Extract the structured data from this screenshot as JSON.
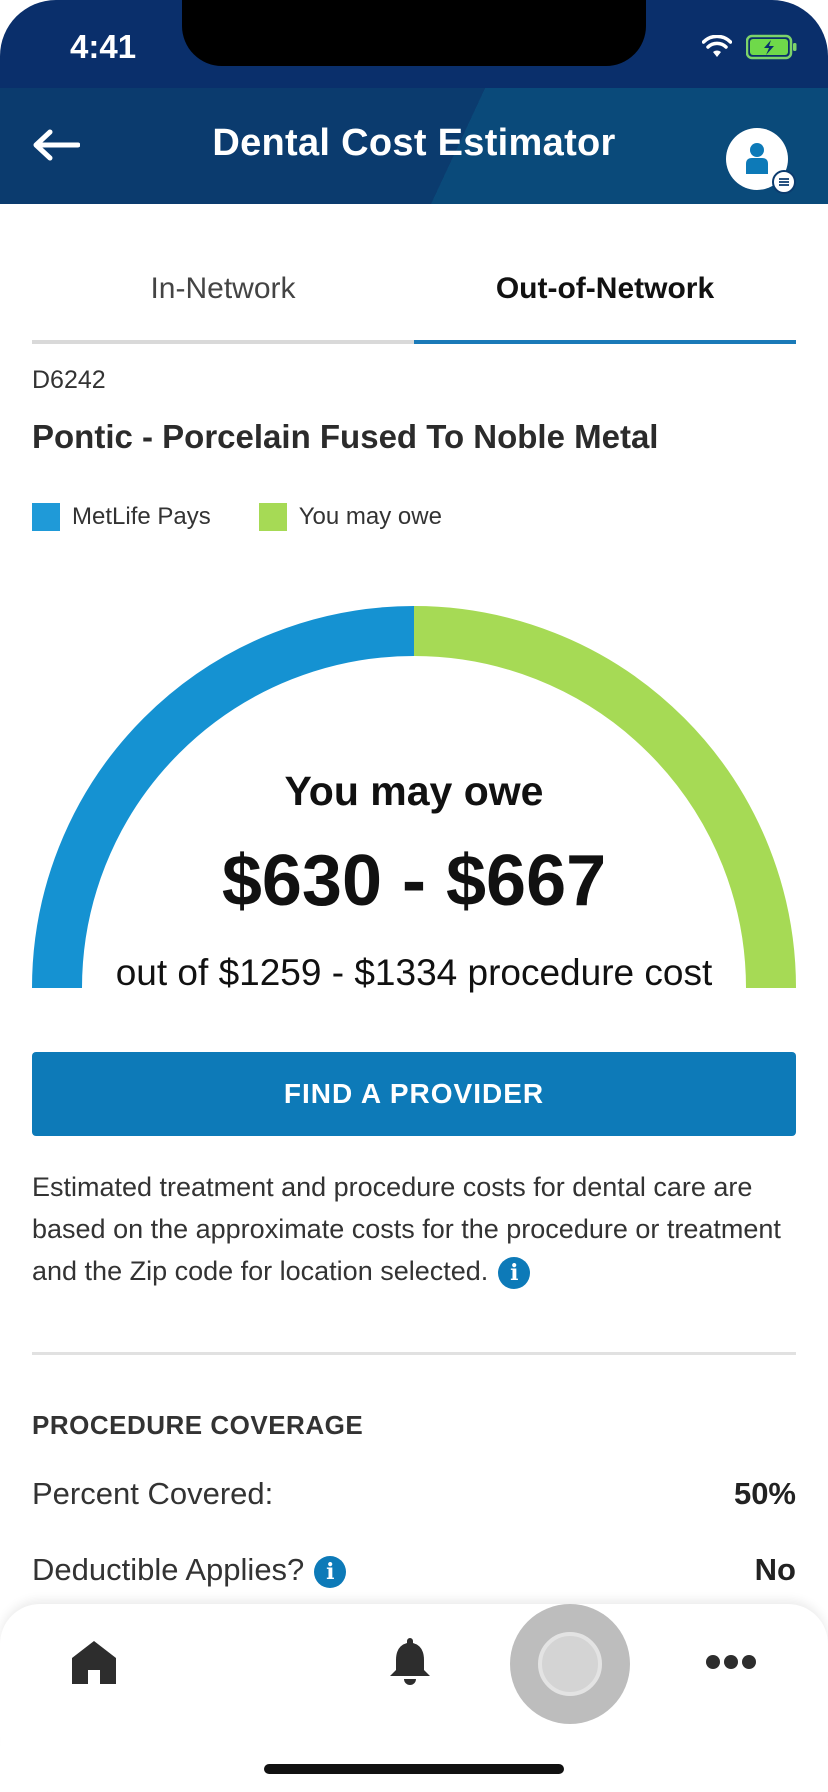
{
  "status_bar": {
    "time": "4:41"
  },
  "header": {
    "title": "Dental Cost Estimator"
  },
  "tabs": [
    {
      "label": "In-Network",
      "selected": false
    },
    {
      "label": "Out-of-Network",
      "selected": true
    }
  ],
  "procedure": {
    "code": "D6242",
    "name": "Pontic - Porcelain Fused To Noble Metal"
  },
  "legend": [
    {
      "label": "MetLife Pays",
      "color": "#1f9ad8"
    },
    {
      "label": "You may owe",
      "color": "#a6da55"
    }
  ],
  "gauge": {
    "label": "You may owe",
    "range": "$630 - $667",
    "subtext": "out of $1259 - $1334 procedure cost",
    "metlife_share": 0.5,
    "owe_share": 0.5,
    "metlife_color": "#1592d2",
    "owe_color": "#a6da55"
  },
  "actions": {
    "find_provider": "FIND A PROVIDER"
  },
  "disclaimer": "Estimated treatment and procedure costs for dental care are based on the approximate costs for the procedure or treatment and the Zip code for location selected.",
  "coverage": {
    "title": "PROCEDURE COVERAGE",
    "rows": [
      {
        "label": "Percent Covered:",
        "value": "50%"
      },
      {
        "label": "Deductible Applies?",
        "value": "No"
      }
    ]
  },
  "bottom_nav": {
    "items": [
      "home-icon",
      "bell-icon",
      "assistant-icon",
      "more-icon"
    ]
  },
  "colors": {
    "header_bg": "#0b3b6e",
    "accent": "#0d7ab8"
  }
}
